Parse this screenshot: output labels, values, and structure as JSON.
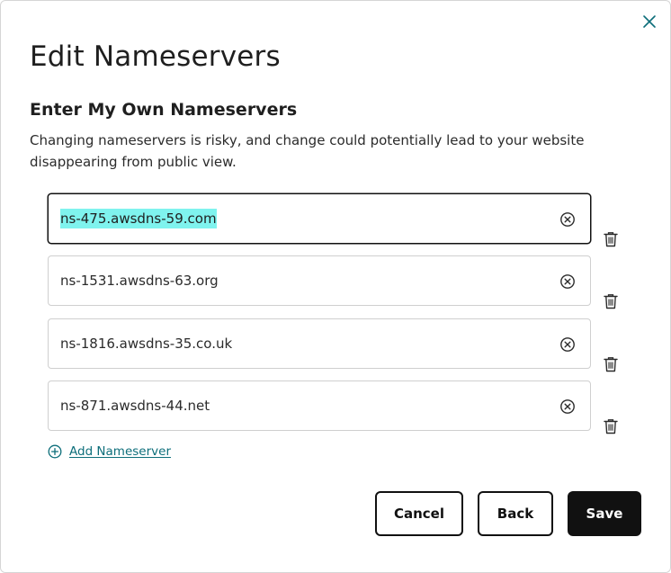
{
  "dialog": {
    "title": "Edit Nameservers",
    "subtitle": "Enter My Own Nameservers",
    "description": "Changing nameservers is risky, and change could potentially lead to your website disappearing from public view."
  },
  "nameservers": [
    {
      "value": "ns-475.awsdns-59.com",
      "focused": true,
      "selected": true
    },
    {
      "value": "ns-1531.awsdns-63.org"
    },
    {
      "value": "ns-1816.awsdns-35.co.uk"
    },
    {
      "value": "ns-871.awsdns-44.net"
    }
  ],
  "add_nameserver_label": "Add Nameserver",
  "buttons": {
    "cancel": "Cancel",
    "back": "Back",
    "save": "Save"
  },
  "colors": {
    "link": "#0d6e7a",
    "selection_highlight": "#7ff3ee",
    "primary_button": "#111111"
  },
  "icons": {
    "close": "close-icon",
    "clear": "clear-circle-x-icon",
    "delete": "trash-icon",
    "add": "plus-circle-icon"
  }
}
